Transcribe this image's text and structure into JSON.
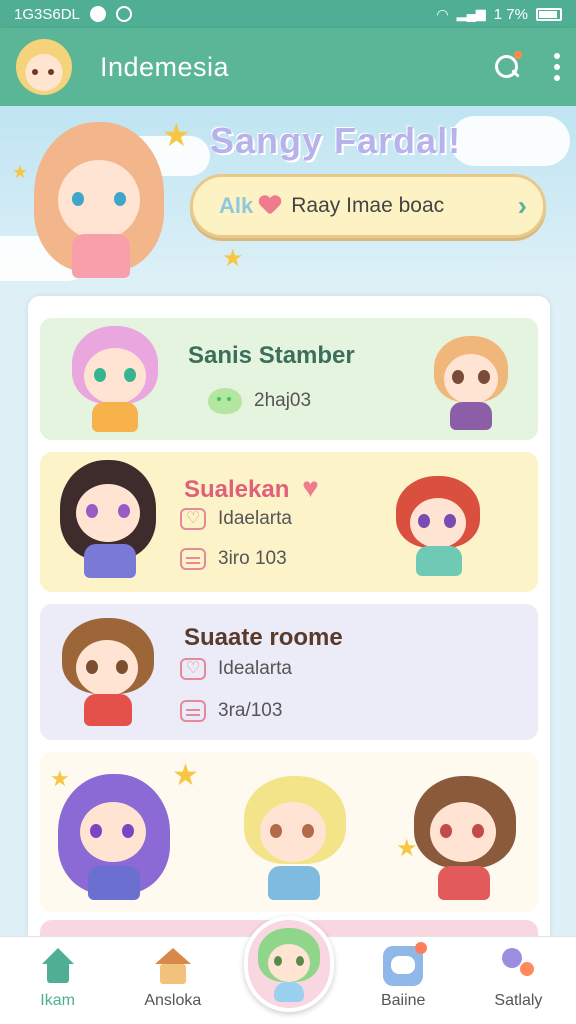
{
  "status_bar": {
    "left_text": "1G3S6DL",
    "battery_text": "1 7%"
  },
  "app_bar": {
    "title": "Indemesia",
    "actions": [
      "search-icon",
      "more-icon"
    ]
  },
  "hero": {
    "title": "Sangy Fardal!",
    "pill_tag": "Alk",
    "pill_text": "Raay Imae boac",
    "pill_chevron": "›"
  },
  "cards": [
    {
      "title": "Sanis Stamber",
      "meta": [
        {
          "icon": "blob-icon",
          "text": "2haj03"
        }
      ],
      "bg": "#e5f4df",
      "title_color": "#3b6f5c"
    },
    {
      "title": "Sualekan",
      "meta": [
        {
          "icon": "heart-icon",
          "text": "Idaelarta"
        },
        {
          "icon": "calendar-icon",
          "text": "3iro 103"
        }
      ],
      "bg": "#fdf3c9",
      "title_color": "#e0607a"
    },
    {
      "title": "Suaate roome",
      "meta": [
        {
          "icon": "heart-icon",
          "text": "Idealarta"
        },
        {
          "icon": "calendar-icon",
          "text": "3ra/103"
        }
      ],
      "bg": "#ecebf8",
      "title_color": "#5a3a2a"
    }
  ],
  "bottom_nav": [
    {
      "label": "Ikam",
      "icon": "home-icon",
      "active": true
    },
    {
      "label": "Ansloka",
      "icon": "house-icon",
      "active": false
    },
    {
      "label": "",
      "icon": "character-avatar-icon",
      "active": false
    },
    {
      "label": "Baiine",
      "icon": "chat-icon",
      "active": false
    },
    {
      "label": "Satlaly",
      "icon": "balloon-icon",
      "active": false
    }
  ],
  "colors": {
    "primary": "#5bb697",
    "accent": "#f4b86c",
    "heart": "#f07b8e"
  }
}
